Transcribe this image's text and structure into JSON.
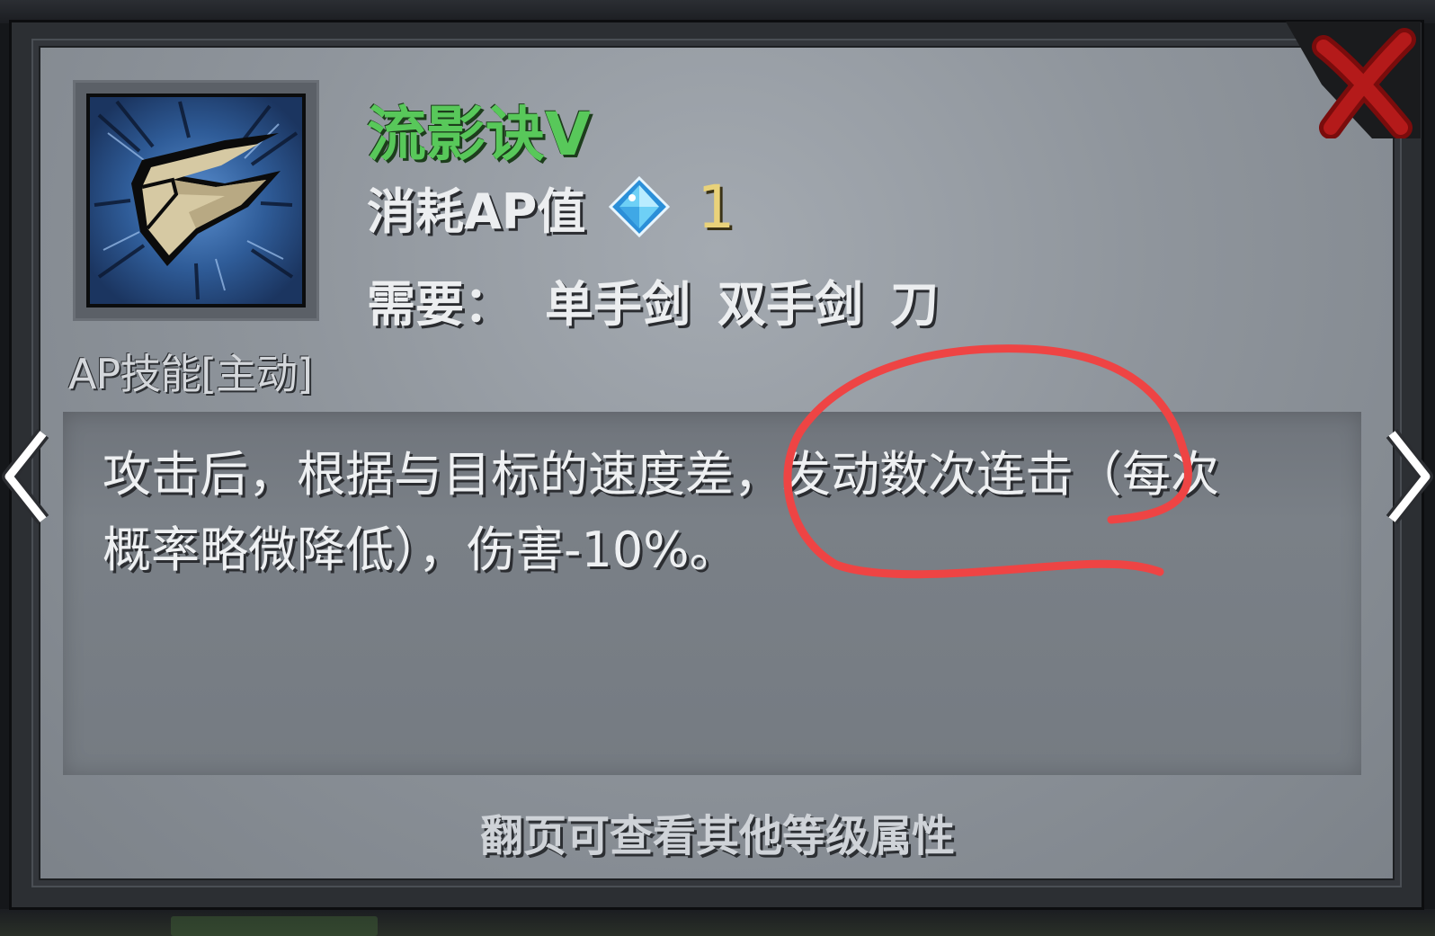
{
  "skill": {
    "name": "流影诀V",
    "type_label": "AP技能[主动]",
    "ap_cost_label": "消耗AP值",
    "ap_cost_value": "1",
    "require_label": "需要：",
    "weapons": [
      "单手剑",
      "双手剑",
      "刀"
    ],
    "description_line1": "攻击后，根据与目标的速度差，发动数次连击（每次",
    "description_line2": "概率略微降低），伤害-10%。"
  },
  "footer": {
    "hint": "翻页可查看其他等级属性"
  },
  "icons": {
    "skill_icon": "blade-wave-skill-icon",
    "ap_gem": "blue-crystal-icon",
    "close": "red-x-close-icon",
    "prev": "chevron-left-icon",
    "next": "chevron-right-icon"
  },
  "colors": {
    "skill_name": "#58c85a",
    "ap_value": "#e9d27a",
    "annotation": "#ee4444",
    "close": "#a81818"
  }
}
